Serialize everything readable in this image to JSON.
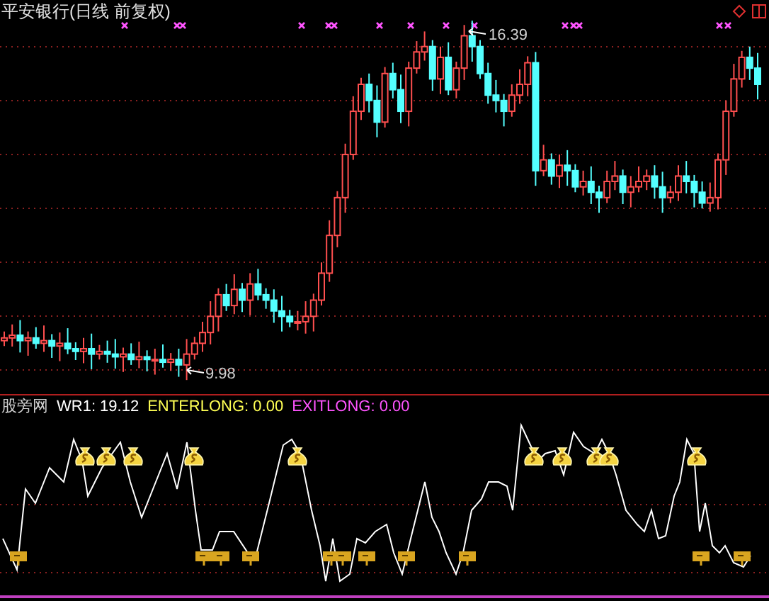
{
  "chart": {
    "title": "平安银行(日线 前复权)",
    "high_label": "16.39",
    "low_label": "9.98"
  },
  "indicator": {
    "name": "股旁网",
    "fields": [
      {
        "label": "WR1: 19.12",
        "color": "#ffffff"
      },
      {
        "label": "ENTERLONG: 0.00",
        "color": "#ffff54"
      },
      {
        "label": "EXITLONG: 0.00",
        "color": "#ff54ff"
      }
    ]
  }
}
